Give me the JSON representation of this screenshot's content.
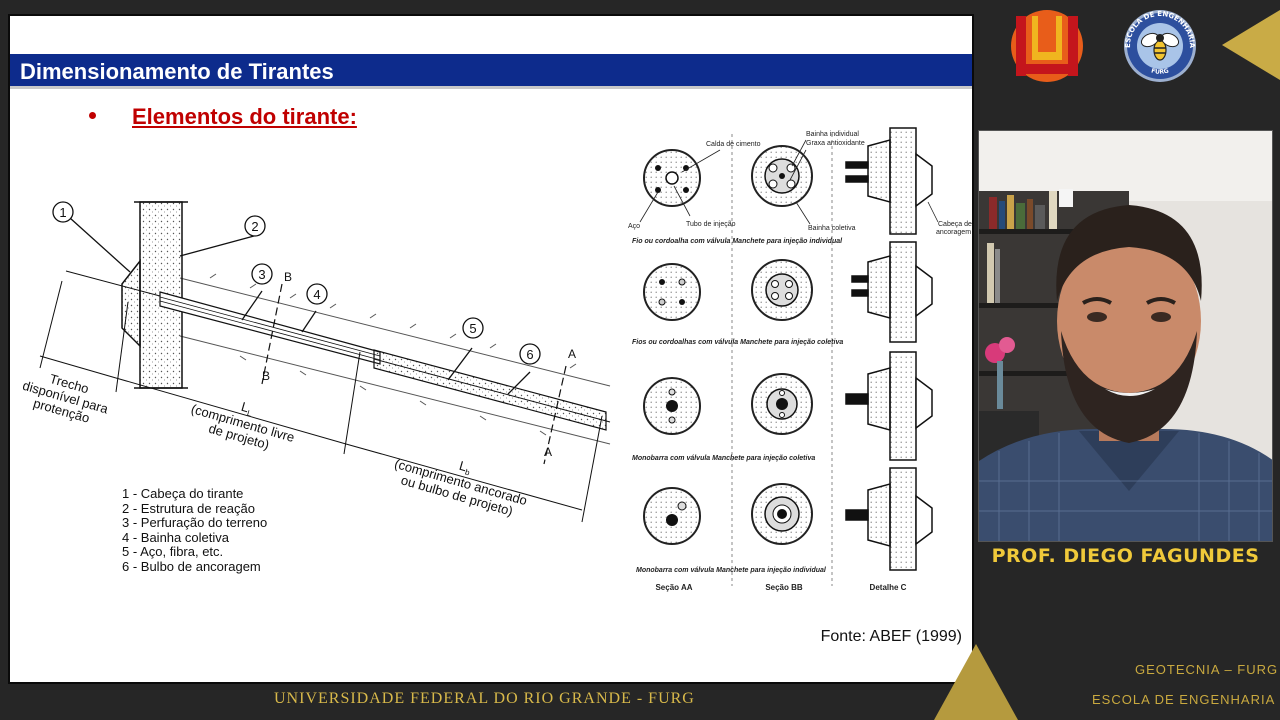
{
  "slide": {
    "title": "Dimensionamento de Tirantes",
    "bullet_heading": "Elementos do tirante:",
    "diagram": {
      "markers": [
        "1",
        "2",
        "3",
        "4",
        "5",
        "6"
      ],
      "section_labels": {
        "b_top": "B",
        "b_bottom": "B",
        "a_top": "A",
        "a_bottom": "A"
      },
      "trecho_lines": [
        "Trecho",
        "disponível para",
        "protenção"
      ],
      "ll_label": "L",
      "ll_sub": "L",
      "ll_lines": [
        "(comprimento livre",
        "de projeto)"
      ],
      "lb_label": "L",
      "lb_sub": "b",
      "lb_lines": [
        "(comprimento ancorado",
        "ou bulbo de projeto)"
      ]
    },
    "legend": [
      "1 - Cabeça do tirante",
      "2 - Estrutura de reação",
      "3 - Perfuração do terreno",
      "4 - Bainha coletiva",
      "5 - Aço, fibra, etc.",
      "6 - Bulbo de ancoragem"
    ],
    "sections_figure": {
      "labels": {
        "calda": "Calda de cimento",
        "bainha_ind": "Bainha individual",
        "graxa": "Graxa antioxidante",
        "aco": "Aço",
        "tubo": "Tubo de injeção",
        "bainha_col": "Bainha coletiva",
        "cabeca_1": "Cabeça de",
        "cabeca_2": "ancoragem"
      },
      "row_captions": [
        "Fio ou cordoalha com válvula Manchete para injeção individual",
        "Fios ou cordoalhas com válvula Manchete para injeção coletiva",
        "Monobarra com válvula Manchete para injeção coletiva",
        "Monobarra com válvula Manchete para injeção individual"
      ],
      "column_captions": [
        "Seção AA",
        "Seção BB",
        "Detalhe C"
      ]
    },
    "source_note": "Fonte: ABEF (1999)"
  },
  "footer": {
    "university": "UNIVERSIDADE FEDERAL DO RIO GRANDE - FURG",
    "line1": "GEOTECNIA – FURG",
    "line2": "ESCOLA DE ENGENHARIA"
  },
  "logos": {
    "eng_ring_text_top": "ESCOLA DE ENGENHARIA",
    "eng_ring_text_bottom": "FURG"
  },
  "presenter": {
    "name": "PROF. DIEGO FAGUNDES"
  },
  "colors": {
    "title_bar": "#0d2b8c",
    "heading_red": "#c00000",
    "gold": "#d8b94a",
    "background": "#262626"
  }
}
